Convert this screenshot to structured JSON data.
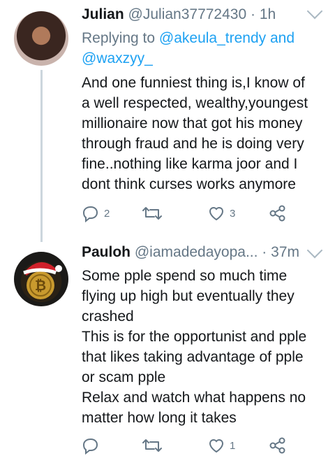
{
  "tweets": [
    {
      "name": "Julian",
      "handle": "@Julian37772430",
      "separator": "·",
      "time": "1h",
      "replying": {
        "prefix": "Replying to",
        "mention1": "@akeula_trendy",
        "joiner": "and",
        "mention2": "@waxzyy_"
      },
      "text": "And one funniest thing is,I know of\na well respected, wealthy,youngest\nmillionaire now that got his money\nthrough fraud and he is doing very\nfine..nothing like karma joor and I\ndont think curses works anymore",
      "actions": {
        "replies": "2",
        "retweets": "",
        "likes": "3"
      }
    },
    {
      "name": "Pauloh",
      "handle": "@iamadedayopa...",
      "separator": "·",
      "time": "37m",
      "text": "Some pple spend so much time\nflying up high but eventually they\ncrashed\nThis is for the opportunist and pple\nthat likes taking advantage of pple\nor scam pple\nRelax and watch what happens no\nmatter how long it takes",
      "actions": {
        "replies": "",
        "retweets": "",
        "likes": "1"
      }
    }
  ],
  "colors": {
    "link": "#1da1f2",
    "muted": "#657786",
    "text": "#14171a",
    "thread": "#ccd6dd"
  }
}
